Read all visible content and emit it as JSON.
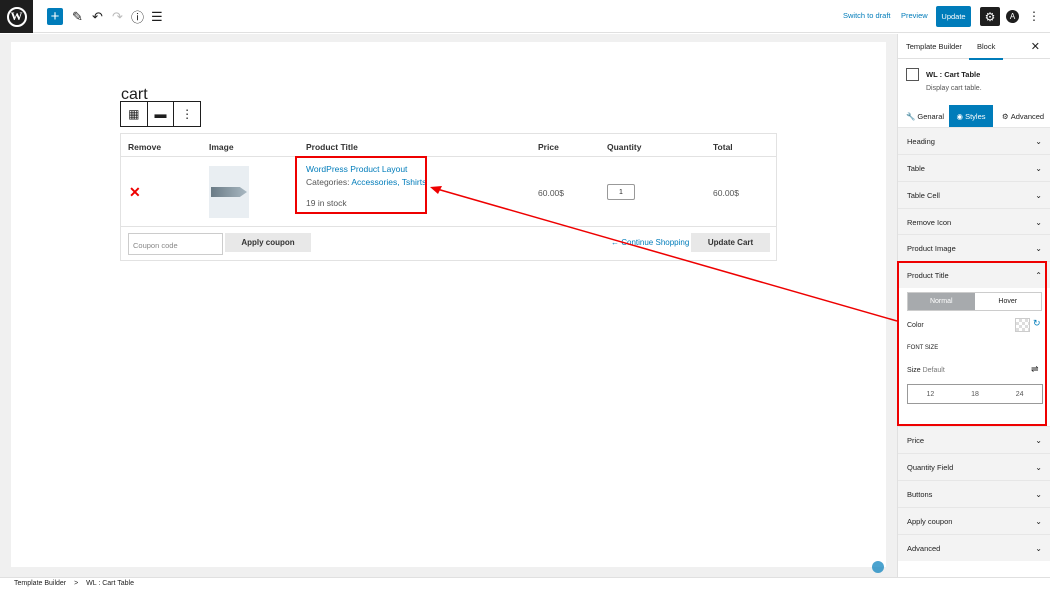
{
  "topbar": {
    "switch_draft": "Switch to draft",
    "preview": "Preview",
    "update": "Update"
  },
  "page": {
    "title": "cart"
  },
  "cart": {
    "headers": [
      "Remove",
      "Image",
      "Product Title",
      "Price",
      "Quantity",
      "Total"
    ],
    "row": {
      "remove": "✕",
      "product_title": "WordPress Product Layout",
      "categories_label": "Categories:",
      "categories": "Accessories, Tshirts",
      "stock": "19 in stock",
      "price": "60.00$",
      "quantity": "1",
      "total": "60.00$"
    },
    "coupon_placeholder": "Coupon code",
    "apply_coupon": "Apply coupon",
    "continue_shopping": "Continue Shopping",
    "update_cart": "Update Cart"
  },
  "sidebar": {
    "tabs": [
      "Template Builder",
      "Block"
    ],
    "block_name": "WL : Cart Table",
    "block_desc": "Display cart table.",
    "mode_tabs": [
      "Genaral",
      "Styles",
      "Advanced"
    ],
    "panels_top": [
      "Heading",
      "Table",
      "Table Cell",
      "Remove Icon",
      "Product Image"
    ],
    "open_panel": {
      "title": "Product Title",
      "normal": "Normal",
      "hover": "Hover",
      "color": "Color",
      "font_size": "FONT SIZE",
      "size": "Size",
      "size_default": "Default",
      "sizes": [
        "12",
        "18",
        "24"
      ]
    },
    "panels_bottom": [
      "Price",
      "Quantity Field",
      "Buttons",
      "Apply coupon",
      "Advanced"
    ]
  },
  "footer": {
    "crumb1": "Template Builder",
    "sep": ">",
    "crumb2": "WL : Cart Table"
  },
  "colors": {
    "accent": "#007cba",
    "highlight": "#e00000"
  }
}
